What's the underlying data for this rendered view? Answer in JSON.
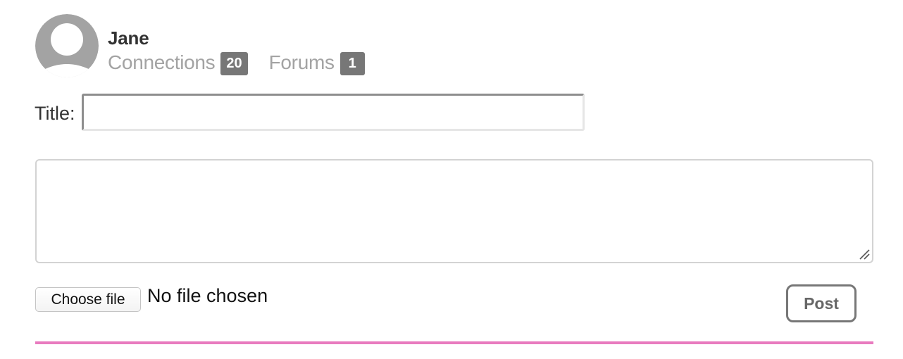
{
  "profile": {
    "name": "Jane",
    "avatar_icon": "default-user-avatar-icon",
    "stats": [
      {
        "label": "Connections",
        "count": "20"
      },
      {
        "label": "Forums",
        "count": "1"
      }
    ]
  },
  "post_form": {
    "title_label": "Title:",
    "title_value": "",
    "title_placeholder": "",
    "body_value": "",
    "body_placeholder": "",
    "file_button_label": "Choose file",
    "file_status": "No file chosen",
    "post_button_label": "Post"
  },
  "colors": {
    "accent_divider": "#e87bbf",
    "badge_background": "#777777",
    "muted_text": "#a3a3a3"
  }
}
